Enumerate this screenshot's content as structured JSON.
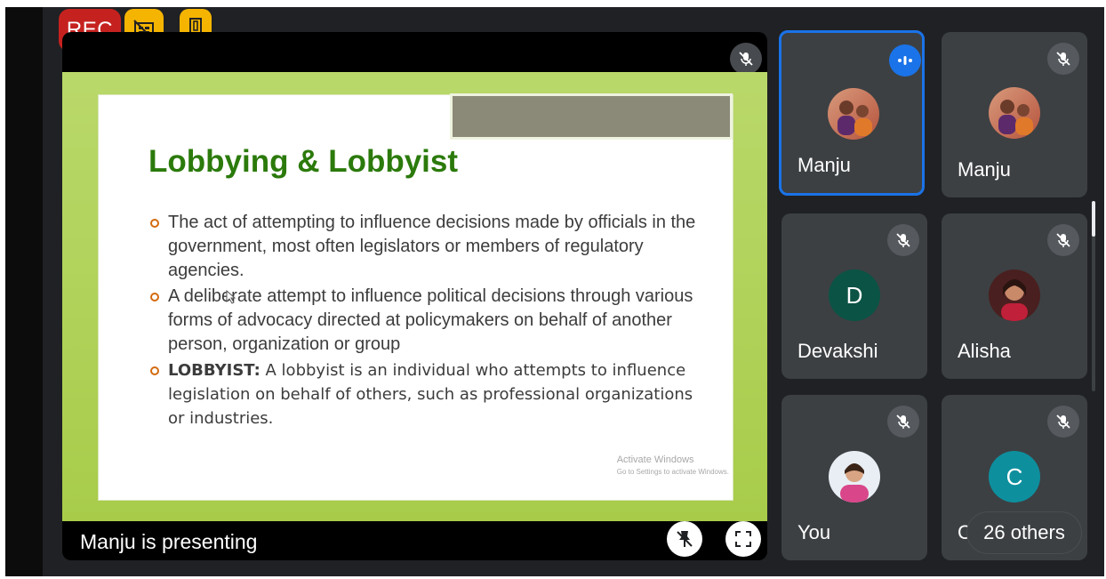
{
  "recording": {
    "label": "REC"
  },
  "indicators": [
    {
      "icon": "captions-off-icon"
    },
    {
      "icon": "door-exit-icon"
    }
  ],
  "presentation": {
    "slide": {
      "title": "Lobbying & Lobbyist",
      "bullets": [
        {
          "prefix": "",
          "text": "The act of attempting to influence decisions made by officials in the government, most often legislators or members of regulatory agencies."
        },
        {
          "prefix": "",
          "text": "A deliberate attempt to influence political decisions through various forms of advocacy directed at policymakers on behalf of another person, organization or group"
        },
        {
          "prefix": "LOBBYIST:",
          "text": "A lobbyist is an individual who attempts to influence legislation on behalf of others, such as professional organizations or industries."
        }
      ],
      "watermark_line1": "Activate Windows",
      "watermark_line2": "Go to Settings to activate Windows."
    },
    "status": "Manju is presenting"
  },
  "participants": [
    {
      "name": "Manju",
      "avatar": "photo",
      "muted": false,
      "speaking": true,
      "active": true
    },
    {
      "name": "Manju",
      "avatar": "photo",
      "muted": true
    },
    {
      "name": "Devakshi",
      "avatar": "D",
      "color": "#0b5345",
      "muted": true
    },
    {
      "name": "Alisha",
      "avatar": "photo",
      "muted": true
    },
    {
      "name": "You",
      "avatar": "photo",
      "muted": true
    },
    {
      "name": "C",
      "avatar": "C",
      "color": "#0e8f9e",
      "muted": true
    }
  ],
  "others": {
    "label": "26 others"
  },
  "colors": {
    "accent": "#1a73e8",
    "record": "#c5221f",
    "indicator": "#f4b400",
    "slide_title": "#2b7a0b"
  }
}
